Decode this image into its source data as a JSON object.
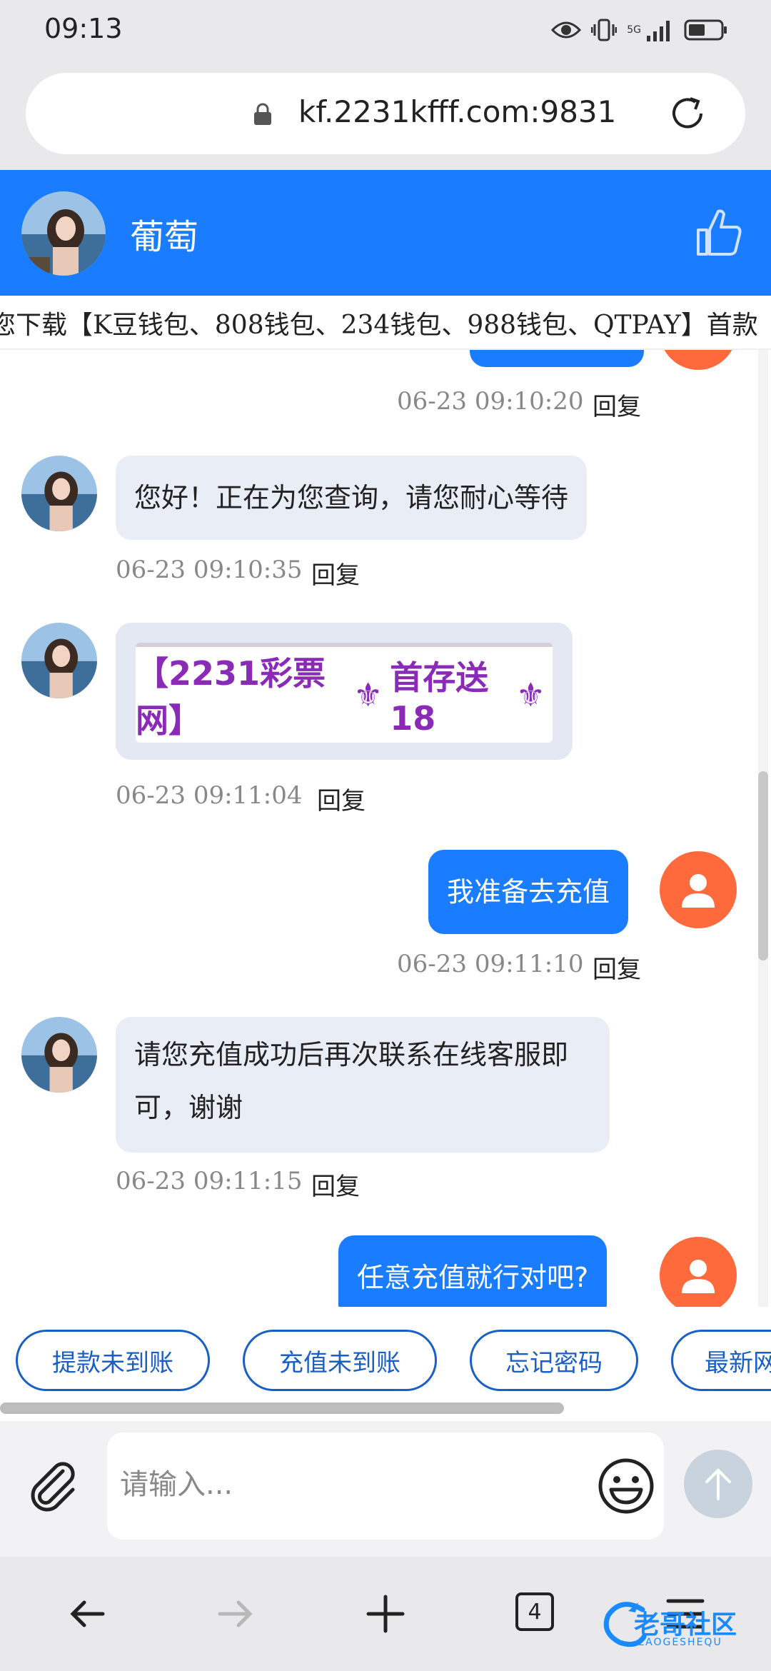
{
  "status_bar": {
    "time": "09:13",
    "network": "5G"
  },
  "browser": {
    "url": "kf.2231kfff.com:9831",
    "tabs_count": "4"
  },
  "chat_header": {
    "title": "葡萄"
  },
  "marquee": {
    "text": "您下载【K豆钱包、808钱包、234钱包、988钱包、QTPAY】首款"
  },
  "messages": [
    {
      "side": "right",
      "text": "",
      "time": "06-23 09:10:20",
      "reply": "回复"
    },
    {
      "side": "left",
      "text": "您好！正在为您查询，请您耐心等待",
      "time": "06-23 09:10:35",
      "reply": "回复"
    },
    {
      "side": "left",
      "type": "image",
      "image_text": "【2231彩票网】⚜首存送18⚜",
      "time": "06-23 09:11:04",
      "reply": "回复"
    },
    {
      "side": "right",
      "text": "我准备去充值",
      "time": "06-23 09:11:10",
      "reply": "回复"
    },
    {
      "side": "left",
      "text_line1": "请您充值成功后再次联系在线客服即",
      "text_line2": "可，谢谢",
      "time": "06-23 09:11:15",
      "reply": "回复"
    },
    {
      "side": "right",
      "text": "任意充值就行对吧?"
    }
  ],
  "promo": {
    "part1": "【2231彩票网】",
    "part2": "首存送18"
  },
  "quick_replies": [
    "提款未到账",
    "充值未到账",
    "忘记密码",
    "最新网"
  ],
  "input": {
    "placeholder": "请输入..."
  },
  "watermark": {
    "text": "老哥社区",
    "sub": "LAOGESHEQU"
  },
  "colors": {
    "brand_blue": "#1a7cff",
    "user_avatar": "#ff6a3c",
    "chip_border": "#1a5fc4"
  }
}
